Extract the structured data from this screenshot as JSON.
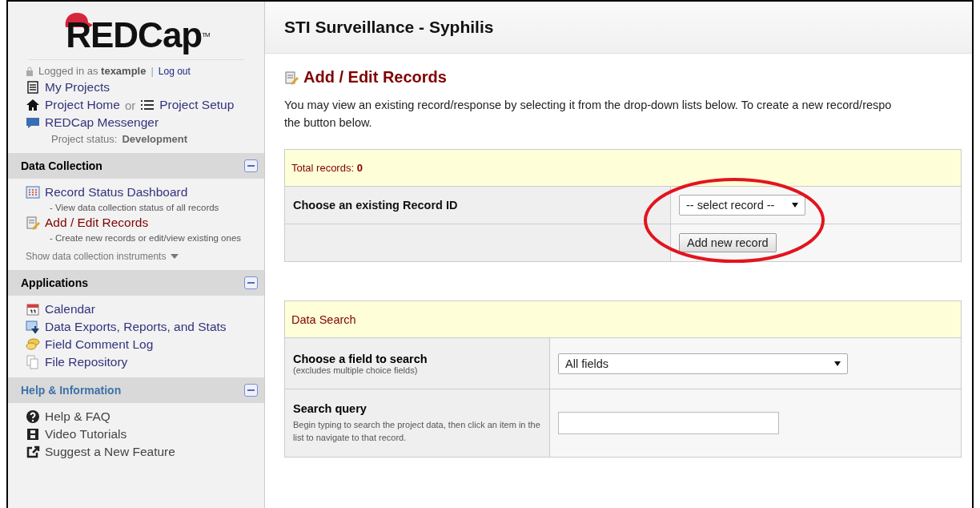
{
  "logo": {
    "text": "REDCap",
    "tm": "TM"
  },
  "login": {
    "prefix": "Logged in as",
    "user": "texample",
    "separator": "|",
    "logout": "Log out"
  },
  "top_links": [
    {
      "label": "My Projects"
    },
    {
      "label": "Project Home",
      "joiner": "or",
      "second": "Project Setup"
    },
    {
      "label": "REDCap Messenger"
    }
  ],
  "project_status": {
    "label": "Project status:",
    "value": "Development"
  },
  "sections": [
    {
      "title": "Data Collection",
      "color": "#000000",
      "items": [
        {
          "label": "Record Status Dashboard",
          "note": "- View data collection status of all records",
          "selected": false
        },
        {
          "label": "Add / Edit Records",
          "note": "- Create new records or edit/view existing ones",
          "selected": true
        }
      ],
      "footer": "Show data collection instruments"
    },
    {
      "title": "Applications",
      "color": "#000000",
      "items": [
        {
          "label": "Calendar",
          "selected": false
        },
        {
          "label": "Data Exports, Reports, and Stats",
          "selected": false
        },
        {
          "label": "Field Comment Log",
          "selected": false
        },
        {
          "label": "File Repository",
          "selected": false
        }
      ]
    },
    {
      "title": "Help & Information",
      "color": "#3e72a8",
      "items": [
        {
          "label": "Help & FAQ",
          "selected": false
        },
        {
          "label": "Video Tutorials",
          "selected": false
        },
        {
          "label": "Suggest a New Feature",
          "selected": false
        }
      ]
    }
  ],
  "project_title": "STI Surveillance - Syphilis",
  "page_title": "Add / Edit Records",
  "intro": [
    "You may view an existing record/response by selecting it from the drop-down lists below. To create a new record/respo",
    "the button below."
  ],
  "records_table": {
    "total_label": "Total records:",
    "total": "0",
    "choose_label": "Choose an existing Record ID",
    "select_value": "-- select record --",
    "add_button": "Add new record"
  },
  "annotation": {
    "kind": "ellipse",
    "color": "#e2141e"
  },
  "search_table": {
    "title": "Data Search",
    "field_label": "Choose a field to search",
    "field_note": "(excludes multiple choice fields)",
    "field_value": "All fields",
    "query_label": "Search query",
    "query_note": "Begin typing to search the project data, then click an item in the list to navigate to that record."
  }
}
